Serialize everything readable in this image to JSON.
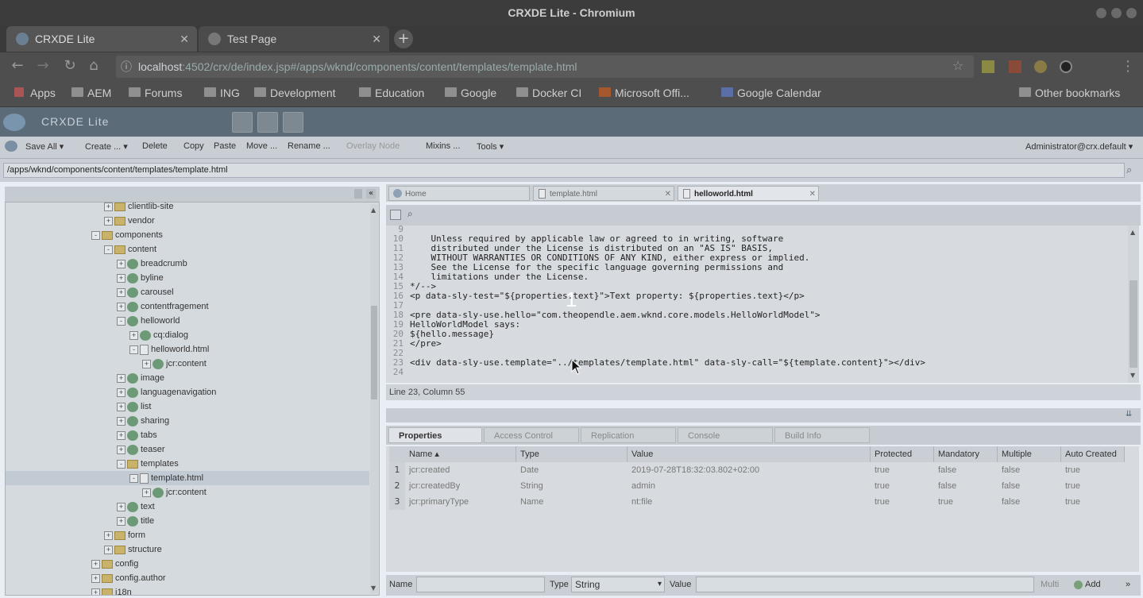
{
  "window": {
    "title": "CRXDE Lite - Chromium"
  },
  "browser": {
    "tabs": [
      {
        "label": "CRXDE Lite"
      },
      {
        "label": "Test Page"
      }
    ],
    "url_host": "localhost",
    "url_rest": ":4502/crx/de/index.jsp#/apps/wknd/components/content/templates/template.html",
    "bookmarks": [
      "Apps",
      "AEM",
      "Forums",
      "ING",
      "Development",
      "Education",
      "Google",
      "Docker CI",
      "Microsoft Offi...",
      "Google Calendar",
      "Other bookmarks"
    ]
  },
  "crx": {
    "logo": "CRXDE Lite",
    "menu": {
      "save_all": "Save All",
      "create": "Create ...",
      "delete": "Delete",
      "copy": "Copy",
      "paste": "Paste",
      "move": "Move ...",
      "rename": "Rename ...",
      "overlay": "Overlay Node",
      "mixins": "Mixins ...",
      "tools": "Tools",
      "user": "Administrator@crx.default"
    },
    "path": "/apps/wknd/components/content/templates/template.html"
  },
  "tree": [
    {
      "label": "clientlib-site",
      "indent": 4,
      "type": "folder",
      "pm": "+"
    },
    {
      "label": "vendor",
      "indent": 4,
      "type": "folder",
      "pm": "+"
    },
    {
      "label": "components",
      "indent": 3,
      "type": "folder",
      "pm": "-"
    },
    {
      "label": "content",
      "indent": 4,
      "type": "folder",
      "pm": "-"
    },
    {
      "label": "breadcrumb",
      "indent": 5,
      "type": "node",
      "pm": "+"
    },
    {
      "label": "byline",
      "indent": 5,
      "type": "node",
      "pm": "+"
    },
    {
      "label": "carousel",
      "indent": 5,
      "type": "node",
      "pm": "+"
    },
    {
      "label": "contentfragement",
      "indent": 5,
      "type": "node",
      "pm": "+"
    },
    {
      "label": "helloworld",
      "indent": 5,
      "type": "node",
      "pm": "-"
    },
    {
      "label": "cq:dialog",
      "indent": 6,
      "type": "node",
      "pm": "+"
    },
    {
      "label": "helloworld.html",
      "indent": 6,
      "type": "file",
      "pm": "-"
    },
    {
      "label": "jcr:content",
      "indent": 7,
      "type": "node",
      "pm": "+"
    },
    {
      "label": "image",
      "indent": 5,
      "type": "node",
      "pm": "+"
    },
    {
      "label": "languagenavigation",
      "indent": 5,
      "type": "node",
      "pm": "+"
    },
    {
      "label": "list",
      "indent": 5,
      "type": "node",
      "pm": "+"
    },
    {
      "label": "sharing",
      "indent": 5,
      "type": "node",
      "pm": "+"
    },
    {
      "label": "tabs",
      "indent": 5,
      "type": "node",
      "pm": "+"
    },
    {
      "label": "teaser",
      "indent": 5,
      "type": "node",
      "pm": "+"
    },
    {
      "label": "templates",
      "indent": 5,
      "type": "folder",
      "pm": "-"
    },
    {
      "label": "template.html",
      "indent": 6,
      "type": "file",
      "pm": "-",
      "selected": true
    },
    {
      "label": "jcr:content",
      "indent": 7,
      "type": "node",
      "pm": "+"
    },
    {
      "label": "text",
      "indent": 5,
      "type": "node",
      "pm": "+"
    },
    {
      "label": "title",
      "indent": 5,
      "type": "node",
      "pm": "+"
    },
    {
      "label": "form",
      "indent": 4,
      "type": "folder",
      "pm": "+"
    },
    {
      "label": "structure",
      "indent": 4,
      "type": "folder",
      "pm": "+"
    },
    {
      "label": "config",
      "indent": 3,
      "type": "folder",
      "pm": "+"
    },
    {
      "label": "config.author",
      "indent": 3,
      "type": "folder",
      "pm": "+"
    },
    {
      "label": "i18n",
      "indent": 3,
      "type": "folder",
      "pm": "+"
    }
  ],
  "editor": {
    "tabs": [
      {
        "label": "Home"
      },
      {
        "label": "template.html"
      },
      {
        "label": "helloworld.html"
      }
    ],
    "lines": [
      {
        "n": "9",
        "t": ""
      },
      {
        "n": "10",
        "t": "    Unless required by applicable law or agreed to in writing, software"
      },
      {
        "n": "11",
        "t": "    distributed under the License is distributed on an \"AS IS\" BASIS,"
      },
      {
        "n": "12",
        "t": "    WITHOUT WARRANTIES OR CONDITIONS OF ANY KIND, either express or implied."
      },
      {
        "n": "13",
        "t": "    See the License for the specific language governing permissions and"
      },
      {
        "n": "14",
        "t": "    limitations under the License."
      },
      {
        "n": "15",
        "t": "*/-->"
      },
      {
        "n": "16",
        "t": "<p data-sly-test=\"${properties.text}\">Text property: ${properties.text}</p>"
      },
      {
        "n": "17",
        "t": ""
      },
      {
        "n": "18",
        "t": "<pre data-sly-use.hello=\"com.theopendle.aem.wknd.core.models.HelloWorldModel\">"
      },
      {
        "n": "19",
        "t": "HelloWorldModel says:"
      },
      {
        "n": "20",
        "t": "${hello.message}"
      },
      {
        "n": "21",
        "t": "</pre>"
      },
      {
        "n": "22",
        "t": ""
      },
      {
        "n": "23",
        "t": "<div data-sly-use.template=\"../templates/template.html\" data-sly-call=\"${template.content}\"></div>"
      },
      {
        "n": "24",
        "t": ""
      }
    ],
    "status": "Line 23, Column 55",
    "marker": "1"
  },
  "properties": {
    "tabs": [
      "Properties",
      "Access Control",
      "Replication",
      "Console",
      "Build Info"
    ],
    "columns": [
      "Name",
      "Type",
      "Value",
      "Protected",
      "Mandatory",
      "Multiple",
      "Auto Created"
    ],
    "rows": [
      {
        "n": "1",
        "cells": [
          "jcr:created",
          "Date",
          "2019-07-28T18:32:03.802+02:00",
          "true",
          "false",
          "false",
          "true"
        ]
      },
      {
        "n": "2",
        "cells": [
          "jcr:createdBy",
          "String",
          "admin",
          "true",
          "false",
          "false",
          "true"
        ]
      },
      {
        "n": "3",
        "cells": [
          "jcr:primaryType",
          "Name",
          "nt:file",
          "true",
          "true",
          "false",
          "true"
        ]
      }
    ],
    "add": {
      "name_label": "Name",
      "type_label": "Type",
      "type_value": "String",
      "value_label": "Value",
      "multi_label": "Multi",
      "add_label": "Add"
    }
  }
}
